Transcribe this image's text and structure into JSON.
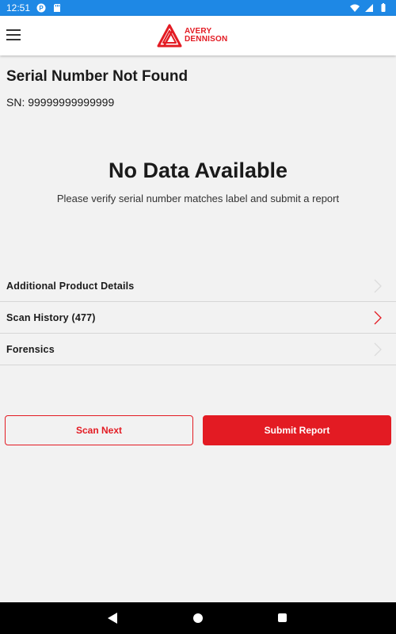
{
  "status_bar": {
    "time": "12:51",
    "icons": [
      "notification-icon",
      "sd-card-icon",
      "wifi-icon",
      "signal-icon",
      "battery-icon"
    ]
  },
  "app_bar": {
    "menu_icon": "hamburger-menu-icon",
    "logo_line1": "AVERY",
    "logo_line2": "DENNISON",
    "brand_color": "#e31b23"
  },
  "main": {
    "title": "Serial Number Not Found",
    "serial": "SN: 99999999999999",
    "empty_title": "No Data Available",
    "empty_subtitle": "Please verify serial number matches label and submit a report"
  },
  "list": [
    {
      "label": "Additional Product Details",
      "enabled": false
    },
    {
      "label": "Scan History (477)",
      "enabled": true
    },
    {
      "label": "Forensics",
      "enabled": false
    }
  ],
  "buttons": {
    "scan_next": "Scan Next",
    "submit_report": "Submit Report"
  },
  "colors": {
    "status_bar": "#1e88e5",
    "accent": "#e31b23",
    "background": "#f2f2f2"
  }
}
